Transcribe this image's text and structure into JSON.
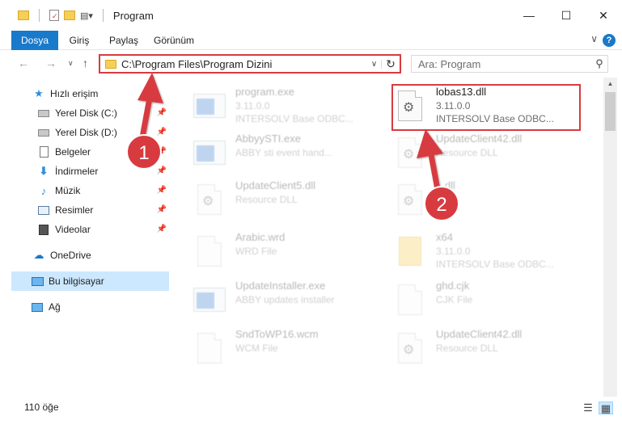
{
  "window": {
    "title": "Program",
    "buttons": {
      "minimize": "—",
      "maximize": "☐",
      "close": "✕"
    }
  },
  "ribbon": {
    "tabs": [
      "Dosya",
      "Giriş",
      "Paylaş",
      "Görünüm"
    ],
    "help": "?",
    "expand": "∨"
  },
  "nav": {
    "back": "←",
    "forward": "→",
    "recent": "∨",
    "up": "↑",
    "address": "C:\\Program Files\\Program Dizini",
    "address_dropdown": "∨",
    "refresh": "↻",
    "search_placeholder": "Ara: Program",
    "search_icon": "search-icon"
  },
  "sidebar": {
    "items": [
      {
        "label": "Hızlı erişim",
        "icon": "star-icon",
        "pinned": false
      },
      {
        "label": "Yerel Disk (C:)",
        "icon": "drive-icon",
        "pinned": true
      },
      {
        "label": "Yerel Disk (D:)",
        "icon": "drive-icon",
        "pinned": true
      },
      {
        "label": "Belgeler",
        "icon": "documents-icon",
        "pinned": true
      },
      {
        "label": "İndirmeler",
        "icon": "download-icon",
        "pinned": true
      },
      {
        "label": "Müzik",
        "icon": "music-icon",
        "pinned": true
      },
      {
        "label": "Resimler",
        "icon": "pictures-icon",
        "pinned": true
      },
      {
        "label": "Videolar",
        "icon": "videos-icon",
        "pinned": true
      },
      {
        "label": "OneDrive",
        "icon": "cloud-icon",
        "pinned": false
      },
      {
        "label": "Bu bilgisayar",
        "icon": "computer-icon",
        "pinned": false,
        "selected": true
      },
      {
        "label": "Ağ",
        "icon": "network-icon",
        "pinned": false
      }
    ]
  },
  "files": [
    {
      "name": "program.exe",
      "line2": "3.11.0.0",
      "line3": "INTERSOLV Base ODBC...",
      "icon": "exe-icon",
      "faded": true
    },
    {
      "name": "lobas13.dll",
      "line2": "3.11.0.0",
      "line3": "INTERSOLV Base ODBC...",
      "icon": "dll-icon",
      "faded": false,
      "highlighted": true
    },
    {
      "name": "AbbyySTI.exe",
      "line2": "ABBY sti event hand...",
      "line3": "",
      "icon": "exe-icon",
      "faded": true
    },
    {
      "name": "UpdateClient42.dll",
      "line2": "Resource DLL",
      "line3": "",
      "icon": "dll-icon",
      "faded": true
    },
    {
      "name": "UpdateClient5.dll",
      "line2": "Resource DLL",
      "line3": "",
      "icon": "dll-icon",
      "faded": true
    },
    {
      "name": "...dll",
      "line2": "...",
      "line3": "",
      "icon": "dll-icon",
      "faded": true
    },
    {
      "name": "Arabic.wrd",
      "line2": "WRD File",
      "line3": "",
      "icon": "file-icon",
      "faded": true
    },
    {
      "name": "x64",
      "line2": "3.11.0.0",
      "line3": "INTERSOLV Base ODBC...",
      "icon": "folder-icon",
      "faded": true
    },
    {
      "name": "UpdateInstaller.exe",
      "line2": "ABBY updates installer",
      "line3": "",
      "icon": "exe-icon",
      "faded": true
    },
    {
      "name": "ghd.cjk",
      "line2": "CJK File",
      "line3": "",
      "icon": "file-icon",
      "faded": true
    },
    {
      "name": "SndToWP16.wcm",
      "line2": "WCM File",
      "line3": "",
      "icon": "file-icon",
      "faded": true
    },
    {
      "name": "UpdateClient42.dll",
      "line2": "Resource DLL",
      "line3": "",
      "icon": "dll-icon",
      "faded": true
    }
  ],
  "status": {
    "count": "110 öğe"
  },
  "callouts": [
    {
      "number": "1",
      "color": "#d73b40"
    },
    {
      "number": "2",
      "color": "#d73b40"
    }
  ],
  "colors": {
    "accent": "#1979ca",
    "highlight_red": "#d73b40",
    "selection": "#cce8ff"
  }
}
